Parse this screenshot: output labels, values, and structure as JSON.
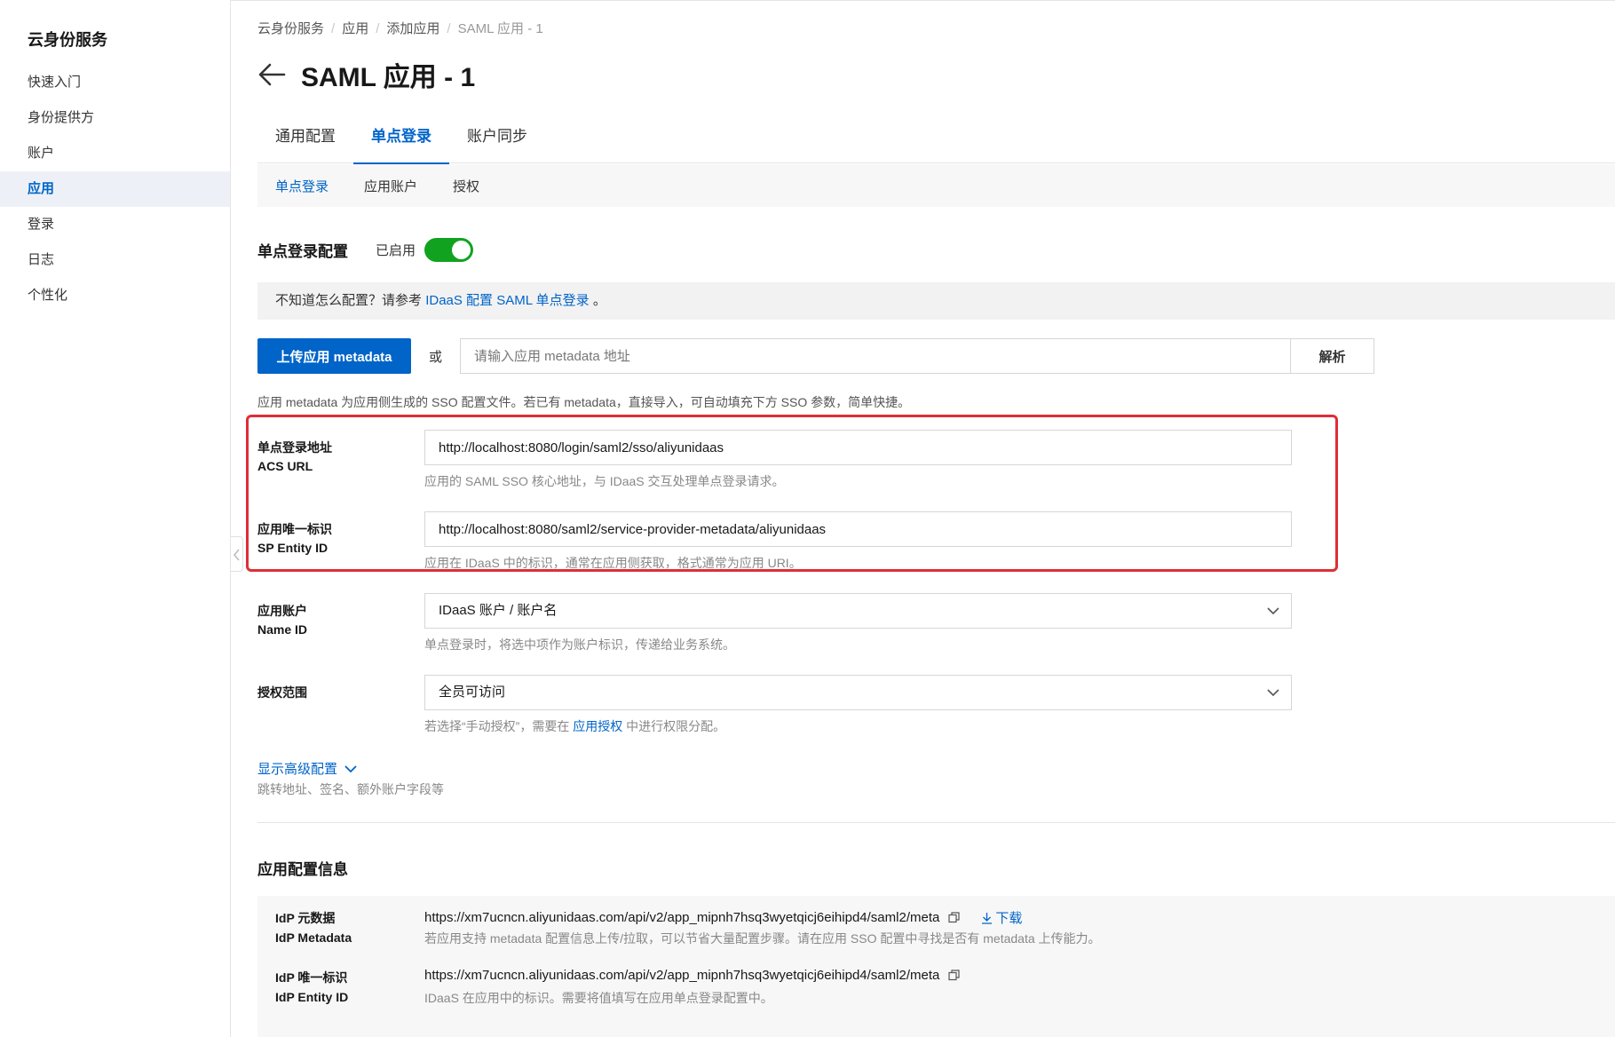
{
  "sidebar": {
    "title": "云身份服务",
    "items": [
      {
        "label": "快速入门",
        "active": false
      },
      {
        "label": "身份提供方",
        "active": false
      },
      {
        "label": "账户",
        "active": false
      },
      {
        "label": "应用",
        "active": true
      },
      {
        "label": "登录",
        "active": false
      },
      {
        "label": "日志",
        "active": false
      },
      {
        "label": "个性化",
        "active": false
      }
    ]
  },
  "breadcrumb": [
    "云身份服务",
    "应用",
    "添加应用",
    "SAML 应用 - 1"
  ],
  "page_title": "SAML 应用 - 1",
  "tabs": [
    {
      "label": "通用配置",
      "active": false
    },
    {
      "label": "单点登录",
      "active": true
    },
    {
      "label": "账户同步",
      "active": false
    }
  ],
  "subtabs": [
    {
      "label": "单点登录",
      "active": true
    },
    {
      "label": "应用账户",
      "active": false
    },
    {
      "label": "授权",
      "active": false
    }
  ],
  "sso": {
    "label": "单点登录配置",
    "status": "已启用",
    "enabled": true,
    "toggle_color": "#11a320"
  },
  "tip": {
    "prefix": "不知道怎么配置？请参考",
    "link": "IDaaS 配置 SAML 单点登录",
    "suffix": "。"
  },
  "metadata": {
    "upload_label": "上传应用 metadata",
    "or": "或",
    "placeholder": "请输入应用 metadata 地址",
    "parse_label": "解析",
    "hint": "应用 metadata 为应用侧生成的 SSO 配置文件。若已有 metadata，直接导入，可自动填充下方 SSO 参数，简单快捷。"
  },
  "form": {
    "acs": {
      "label_cn": "单点登录地址",
      "label_en": "ACS URL",
      "value": "http://localhost:8080/login/saml2/sso/aliyunidaas",
      "help": "应用的 SAML SSO 核心地址，与 IDaaS 交互处理单点登录请求。"
    },
    "entity": {
      "label_cn": "应用唯一标识",
      "label_en": "SP Entity ID",
      "value": "http://localhost:8080/saml2/service-provider-metadata/aliyunidaas",
      "help": "应用在 IDaaS 中的标识，通常在应用侧获取，格式通常为应用 URI。"
    },
    "nameid": {
      "label_cn": "应用账户",
      "label_en": "Name ID",
      "value": "IDaaS 账户 / 账户名",
      "help": "单点登录时，将选中项作为账户标识，传递给业务系统。"
    },
    "scope": {
      "label_cn": "授权范围",
      "value": "全员可访问",
      "help_prefix": "若选择“手动授权”，需要在",
      "help_link": "应用授权",
      "help_suffix": "中进行权限分配。"
    }
  },
  "advanced": {
    "label": "显示高级配置",
    "hint": "跳转地址、签名、额外账户字段等"
  },
  "app_info": {
    "title": "应用配置信息",
    "rows": [
      {
        "label_cn": "IdP 元数据",
        "label_en": "IdP Metadata",
        "value": "https://xm7ucncn.aliyunidaas.com/api/v2/app_mipnh7hsq3wyetqicj6eihipd4/saml2/meta",
        "download": "下载",
        "help": "若应用支持 metadata 配置信息上传/拉取，可以节省大量配置步骤。请在应用 SSO 配置中寻找是否有 metadata 上传能力。"
      },
      {
        "label_cn": "IdP 唯一标识",
        "label_en": "IdP Entity ID",
        "value": "https://xm7ucncn.aliyunidaas.com/api/v2/app_mipnh7hsq3wyetqicj6eihipd4/saml2/meta",
        "help": "IDaaS 在应用中的标识。需要将值填写在应用单点登录配置中。"
      }
    ]
  },
  "colors": {
    "primary": "#0064c8",
    "highlight": "#e02d36",
    "brand_accent": "#ff6a00"
  }
}
